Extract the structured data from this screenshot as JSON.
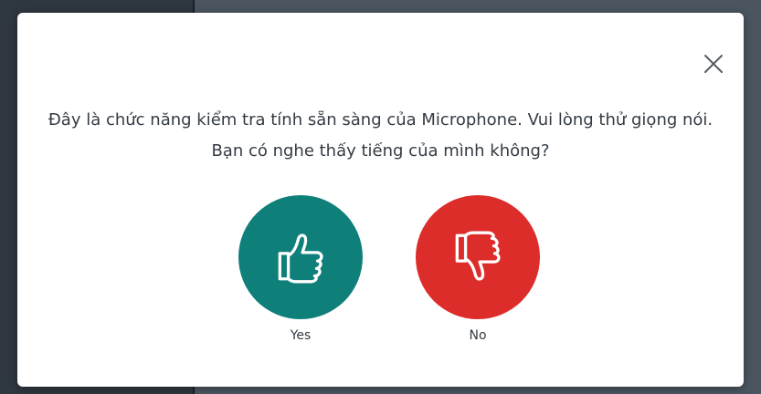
{
  "dialog": {
    "message": "Đây là chức năng kiểm tra tính sẵn sàng của Microphone. Vui lòng thử giọng nói. Bạn có nghe thấy tiếng của mình không?",
    "close_icon": "close-icon"
  },
  "choices": {
    "yes": {
      "label": "Yes",
      "icon": "thumbs-up-icon",
      "color": "#0f7f7a"
    },
    "no": {
      "label": "No",
      "icon": "thumbs-down-icon",
      "color": "#dd2d2b"
    }
  }
}
